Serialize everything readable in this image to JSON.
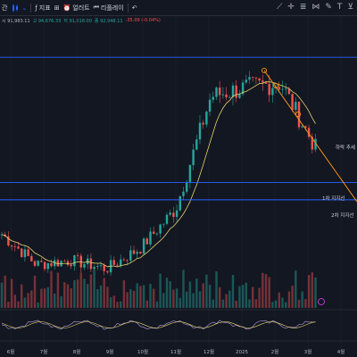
{
  "toolbar": {
    "interval_label": "간",
    "indicator_label": "지표",
    "alert_label": "얼러트",
    "replay_label": "리플레이",
    "chart_type_icon": "candles-icon",
    "undo_icon": "undo-icon"
  },
  "ohlc": {
    "open": "시 91,983.11",
    "high": "고 94,676.33",
    "low": "저 91,618.00",
    "close": "종 92,948.11",
    "change": "-35.09 (-0.04%)"
  },
  "annotations": {
    "trend_label": "하락 추세",
    "support1_label": "1차 지지선",
    "support2_label": "2차 지지선"
  },
  "time_axis": [
    "6월",
    "7월",
    "8월",
    "9월",
    "10월",
    "11월",
    "12월",
    "2025",
    "2월",
    "3월",
    "4월"
  ],
  "colors": {
    "background": "#131722",
    "up": "#26a69a",
    "down": "#ef5350",
    "support_line": "#2962ff",
    "trend_line": "#f7931a",
    "moving_average": "#e6d26b"
  },
  "chart_data": {
    "type": "candlestick",
    "title": "",
    "xlabel": "",
    "ylabel": "",
    "x": [
      "6월",
      "7월",
      "8월",
      "9월",
      "10월",
      "11월",
      "12월",
      "2025",
      "2월",
      "3월",
      "4월"
    ],
    "price_trend": [
      66000,
      59000,
      60000,
      58000,
      63000,
      72000,
      98000,
      100000,
      101000,
      86000,
      83000
    ],
    "support_levels": [
      78000,
      74000
    ],
    "resistance_level": 107000,
    "y_range": [
      50000,
      112000
    ]
  }
}
